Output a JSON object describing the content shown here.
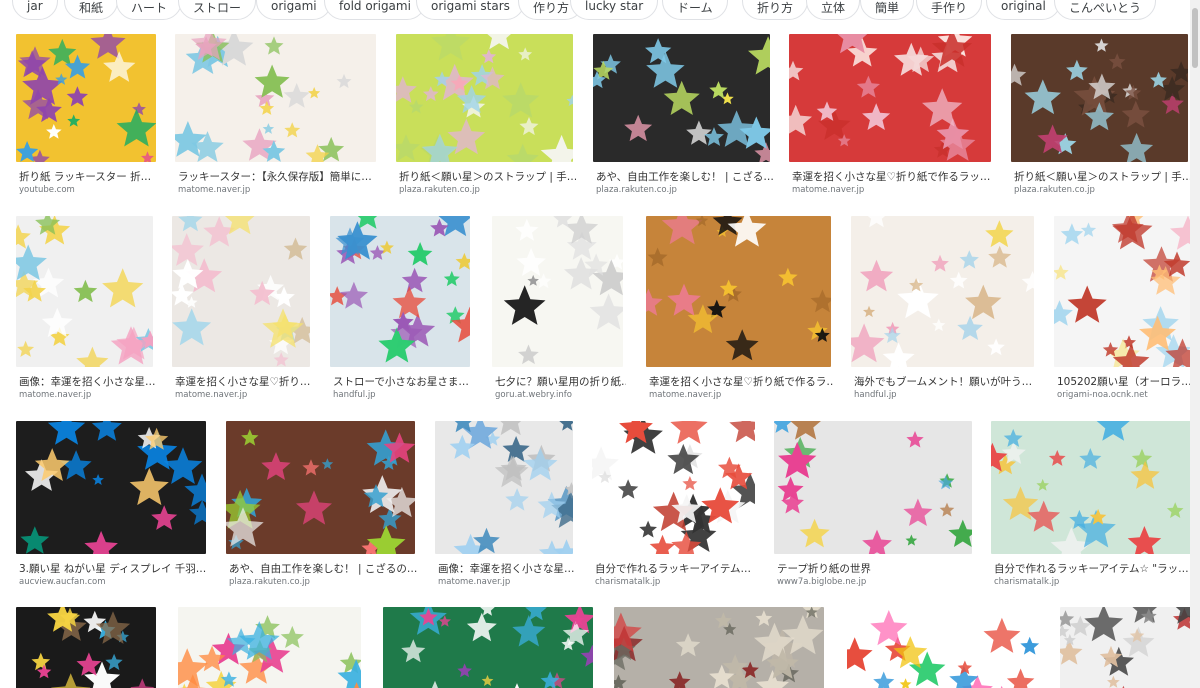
{
  "chips": [
    "jar",
    "和紙",
    "ハート",
    "ストロー",
    "origami",
    "fold origami",
    "origami stars",
    "作り方",
    "lucky star",
    "ドーム",
    "折り方",
    "立体",
    "簡単",
    "手作り",
    "original",
    "こんぺいとう"
  ],
  "rows": [
    [
      {
        "caption": "折り紙 ラッキースター 折…",
        "source": "youtube.com",
        "colors": [
          "#f2c230",
          "#e74c8b",
          "#3aa0e0",
          "#8e44ad",
          "#27ae60",
          "#ffffff"
        ]
      },
      {
        "caption": "ラッキースター：【永久保存版】簡単に…",
        "source": "matome.naver.jp",
        "colors": [
          "#f5f0ea",
          "#e8a3c0",
          "#7ec8e3",
          "#f3d34a",
          "#88c057",
          "#d9d9d9"
        ]
      },
      {
        "caption": "折り紙＜願い星＞のストラップ | 手…",
        "source": "plaza.rakuten.co.jp",
        "colors": [
          "#c9df5a",
          "#f5f5f0",
          "#e2b4d4",
          "#9fd3ea",
          "#f7a8b8",
          "#b9d96a"
        ]
      },
      {
        "caption": "あや、自由工作を楽しむ！ | こざる…",
        "source": "plaza.rakuten.co.jp",
        "colors": [
          "#2a2a2a",
          "#f0f0f0",
          "#f5a3b8",
          "#7fc9e8",
          "#b8d960",
          "#f3e34c"
        ]
      },
      {
        "caption": "幸運を招く小さな星♡折り紙で作るラッ…",
        "source": "matome.naver.jp",
        "colors": [
          "#d63a3a",
          "#f5d9d9",
          "#e88ea4",
          "#fff5f0",
          "#c9302c",
          "#f0b8c8"
        ]
      },
      {
        "caption": "折り紙＜願い星＞のストラップ | 手…",
        "source": "plaza.rakuten.co.jp",
        "colors": [
          "#5a3a2a",
          "#3a2a20",
          "#9ad0e0",
          "#c04070",
          "#e0e0e0",
          "#7a5040"
        ]
      }
    ],
    [
      {
        "caption": "画像：幸運を招く小さな星…",
        "source": "matome.naver.jp",
        "colors": [
          "#f0f0f0",
          "#f5a0c0",
          "#f3d34a",
          "#7ec8e3",
          "#88c057",
          "#ffffff"
        ]
      },
      {
        "caption": "幸運を招く小さな星♡折り…",
        "source": "matome.naver.jp",
        "colors": [
          "#ece8e4",
          "#f3c0d0",
          "#a7d7ea",
          "#d6c1a0",
          "#f5e170",
          "#ffffff"
        ]
      },
      {
        "caption": "ストローで小さなお星さま…",
        "source": "handful.jp",
        "colors": [
          "#d9e4ea",
          "#e74c3c",
          "#3a90d0",
          "#f1c40f",
          "#2ecc71",
          "#9b59b6"
        ]
      },
      {
        "caption": "七夕に？願い星用の折り紙…",
        "source": "goru.at.webry.info",
        "colors": [
          "#f7f7f2",
          "#222222",
          "#ffffff",
          "#cccccc",
          "#999999",
          "#e0e0e0"
        ]
      },
      {
        "caption": "幸運を招く小さな星♡折り紙で作るラ…",
        "source": "matome.naver.jp",
        "colors": [
          "#c6843a",
          "#a56a2a",
          "#f07a9a",
          "#f5c030",
          "#ffffff",
          "#101010"
        ]
      },
      {
        "caption": "海外でもブームメント！願いが叶う…",
        "source": "handful.jp",
        "colors": [
          "#f4efe9",
          "#d8b68a",
          "#f09ab8",
          "#f3d860",
          "#a8d4ea",
          "#ffffff"
        ]
      },
      {
        "caption": "105202願い星（オーロラ…",
        "source": "origami-noa.ocnk.net",
        "colors": [
          "#f5f5f5",
          "#f7b7c9",
          "#aad8ef",
          "#f6e58d",
          "#ffbe76",
          "#c0392b"
        ]
      }
    ],
    [
      {
        "caption": "3.願い星 ねがい星 ディスプレイ 千羽…",
        "source": "aucview.aucfan.com",
        "colors": [
          "#1d1d1d",
          "#e84393",
          "#0984e3",
          "#fdcb6e",
          "#00b894",
          "#ffffff"
        ]
      },
      {
        "caption": "あや、自由工作を楽しむ！ | こざるの…",
        "source": "plaza.rakuten.co.jp",
        "colors": [
          "#6b3b2a",
          "#e84380",
          "#35a0d0",
          "#f0f0f0",
          "#9acd32",
          "#ff7675"
        ]
      },
      {
        "caption": "画像：幸運を招く小さな星…",
        "source": "matome.naver.jp",
        "colors": [
          "#e8e8e8",
          "#4a90c0",
          "#a0d0f0",
          "#6fa8dc",
          "#c0c0c0",
          "#3d6a8a"
        ]
      },
      {
        "caption": "自分で作れるラッキーアイテム…",
        "source": "charismatalk.jp",
        "colors": [
          "#ffffff",
          "#e74c3c",
          "#333333",
          "#f5f5f5",
          "#c0392b",
          "#dddddd"
        ]
      },
      {
        "caption": "テープ折り紙の世界",
        "source": "www7a.biglobe.ne.jp",
        "colors": [
          "#e6e6e6",
          "#3aa845",
          "#e84393",
          "#f5d342",
          "#4aa8e0",
          "#b57c4a"
        ]
      },
      {
        "caption": "自分で作れるラッキーアイテム☆ \"ラッ…",
        "source": "charismatalk.jp",
        "colors": [
          "#cfe6d8",
          "#e84c4c",
          "#f5c542",
          "#4ab0e0",
          "#9fd36a",
          "#f3f3f3"
        ]
      }
    ],
    [
      {
        "caption": "",
        "source": "",
        "colors": [
          "#1a1a1a",
          "#3ab0e0",
          "#e84393",
          "#f5d342",
          "#8a6a4a",
          "#ffffff"
        ]
      },
      {
        "caption": "",
        "source": "",
        "colors": [
          "#f5f5f0",
          "#e84393",
          "#3ab0e0",
          "#f5d342",
          "#88c057",
          "#ff8c42"
        ]
      },
      {
        "caption": "",
        "source": "",
        "colors": [
          "#1f7a4a",
          "#3ab0e0",
          "#f5d342",
          "#e84393",
          "#ffffff",
          "#8e44ad"
        ]
      },
      {
        "caption": "",
        "source": "",
        "colors": [
          "#b5b0a8",
          "#d63a3a",
          "#6a6a60",
          "#e8e0d0",
          "#8a2a2a",
          "#c0b8a8"
        ]
      },
      {
        "caption": "",
        "source": "",
        "colors": [
          "#ffffff",
          "#e74c3c",
          "#f1c40f",
          "#2ecc71",
          "#3498db",
          "#ff69b4"
        ]
      },
      {
        "caption": "",
        "source": "",
        "colors": [
          "#f0f0f0",
          "#8a8a8a",
          "#e0c0a0",
          "#c04040",
          "#d0d0d0",
          "#404040"
        ]
      }
    ]
  ]
}
